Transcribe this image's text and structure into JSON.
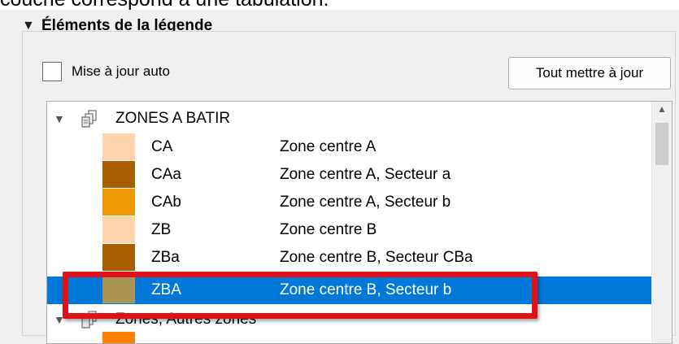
{
  "caption": "couche correspond à une tabulation.",
  "panel": {
    "title": "Éléments de la légende",
    "auto_update_label": "Mise à jour auto",
    "auto_update_checked": false,
    "update_all_button": "Tout mettre à jour"
  },
  "tree": {
    "group": {
      "name": "ZONES A BATIR",
      "expanded": true
    },
    "items": [
      {
        "code": "CA",
        "description": "Zone centre A",
        "color": "#fcd3aa"
      },
      {
        "code": "CAa",
        "description": "Zone centre A, Secteur a",
        "color": "#a95f00"
      },
      {
        "code": "CAb",
        "description": "Zone centre A, Secteur b",
        "color": "#ee9a00"
      },
      {
        "code": "ZB",
        "description": "Zone centre B",
        "color": "#fcd3aa"
      },
      {
        "code": "ZBa",
        "description": "Zone centre B, Secteur CBa",
        "color": "#a95f00"
      },
      {
        "code": "ZBA",
        "description": "Zone centre B, Secteur b",
        "color": "#a99456",
        "selected": true
      }
    ],
    "next_group": {
      "name": "Zones, Autres zones"
    },
    "next_item": {
      "color": "#ff7f00"
    }
  },
  "colors": {
    "selection": "#0078d7",
    "highlight_frame": "#e01219"
  }
}
